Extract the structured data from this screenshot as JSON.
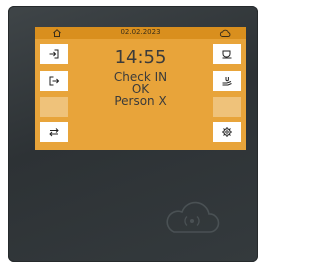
{
  "screen": {
    "date": "02.02.2023",
    "time": "14:55",
    "status_lines": [
      "Check IN",
      "OK",
      "Person X"
    ]
  },
  "icons": {
    "home": "home-icon",
    "cloud": "cloud-icon",
    "check_in": "login-icon",
    "check_out": "logout-icon",
    "transfer": "transfer-icon",
    "coffee": "coffee-cup-icon",
    "break": "hand-cup-icon",
    "settings": "gear-icon",
    "nfc_logo": "cloud-nfc-icon"
  },
  "colors": {
    "screen_bg": "#e8a43a",
    "topbar": "#d98f1e",
    "empty_button": "#efc27a",
    "device_body": "#343a3d"
  }
}
